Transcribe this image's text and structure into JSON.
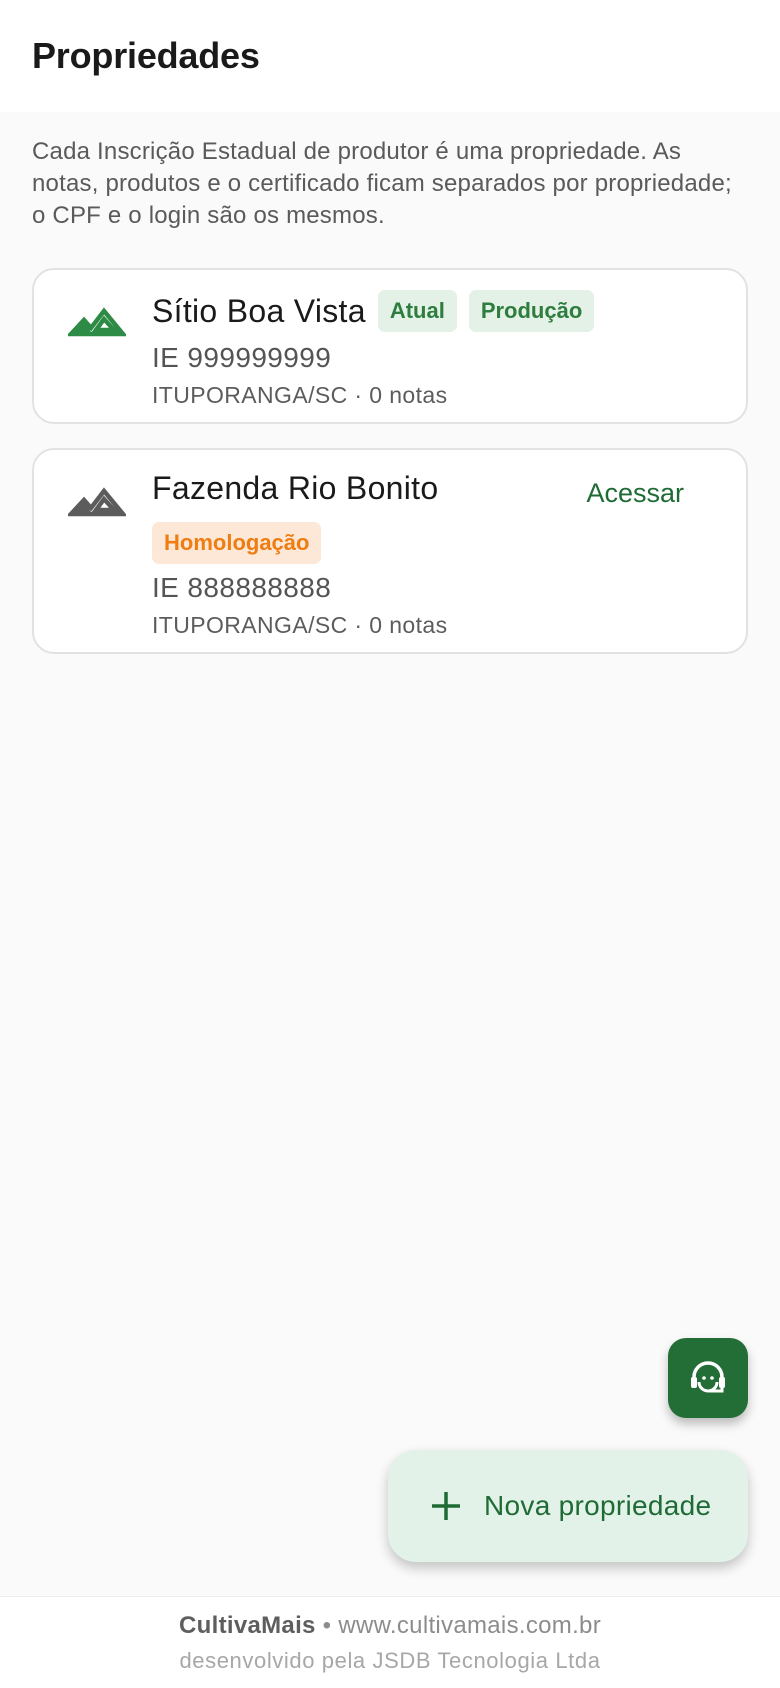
{
  "app_bar": {
    "title": "Propriedades"
  },
  "intro_text": "Cada Inscrição Estadual de produtor é uma propriedade. As notas, produtos e o certificado ficam separados por propriedade; o CPF e o login são os mesmos.",
  "properties": [
    {
      "name": "Sítio Boa Vista",
      "badges": [
        "Atual",
        "Produção"
      ],
      "ie": "IE 999999999",
      "location": "ITUPORANGA/SC · 0 notas",
      "icon": "mountain-icon",
      "icon_color": "#2e8b45"
    },
    {
      "name": "Fazenda Rio Bonito",
      "badges": [
        "Homologação"
      ],
      "ie": "IE 888888888",
      "location": "ITUPORANGA/SC · 0 notas",
      "action_label": "Acessar",
      "icon": "mountain-icon",
      "icon_color": "#5c5c5c"
    }
  ],
  "support_button": {
    "icon": "support-agent-icon",
    "color": "#236e36"
  },
  "new_property_button": {
    "label": "Nova propriedade",
    "icon": "plus-icon"
  },
  "footer": {
    "brand": "CultivaMais",
    "site": "• www.cultivamais.com.br",
    "credit": "desenvolvido pela JSDB Tecnologia Ltda"
  },
  "colors": {
    "primary": "#1f6b35",
    "badge_green_bg": "#e3f1e6",
    "badge_green_text": "#2e7d3e",
    "badge_orange_bg": "#fde8d7",
    "badge_orange_text": "#ef7d12"
  }
}
